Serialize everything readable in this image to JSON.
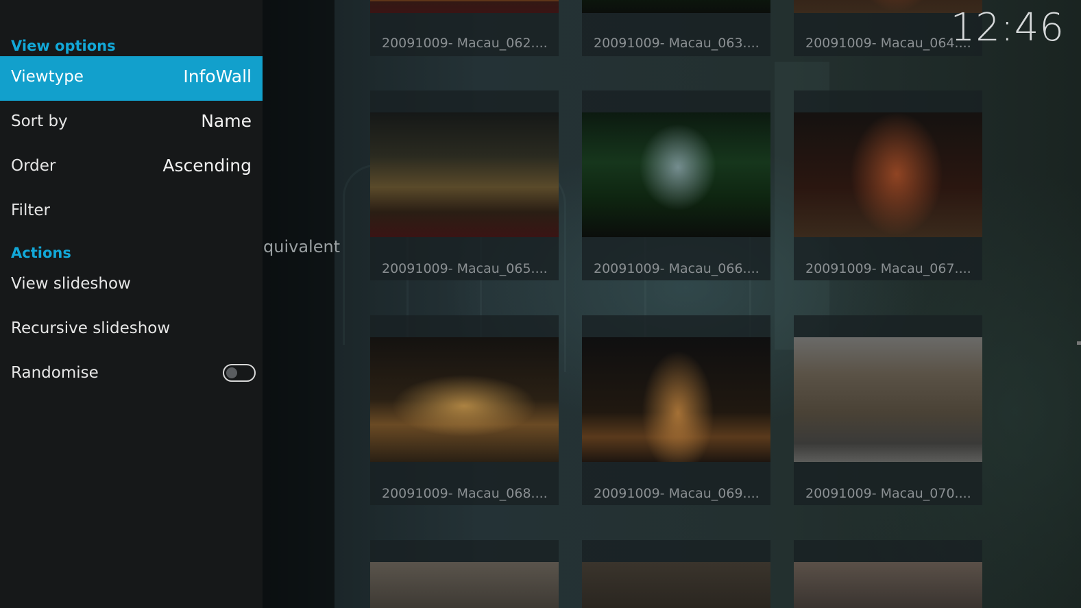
{
  "clock": {
    "time": "12:46"
  },
  "background_label": "quivalent",
  "panel": {
    "sections": {
      "view_options": "View options",
      "actions": "Actions"
    },
    "view_items": [
      {
        "label": "Viewtype",
        "value": "InfoWall",
        "selected": true
      },
      {
        "label": "Sort by",
        "value": "Name",
        "selected": false
      },
      {
        "label": "Order",
        "value": "Ascending",
        "selected": false
      },
      {
        "label": "Filter",
        "value": "",
        "selected": false
      }
    ],
    "action_items": [
      {
        "label": "View slideshow"
      },
      {
        "label": "Recursive slideshow"
      },
      {
        "label": "Randomise",
        "toggle": false
      }
    ]
  },
  "grid": {
    "rows": [
      [
        "20091009- Macau_062....",
        "20091009- Macau_063....",
        "20091009- Macau_064...."
      ],
      [
        "20091009- Macau_065....",
        "20091009- Macau_066....",
        "20091009- Macau_067...."
      ],
      [
        "20091009- Macau_068....",
        "20091009- Macau_069....",
        "20091009- Macau_070...."
      ]
    ]
  },
  "colors": {
    "accent": "#12a0cc",
    "section_header": "#12a8d8",
    "panel_bg": "#161819"
  }
}
